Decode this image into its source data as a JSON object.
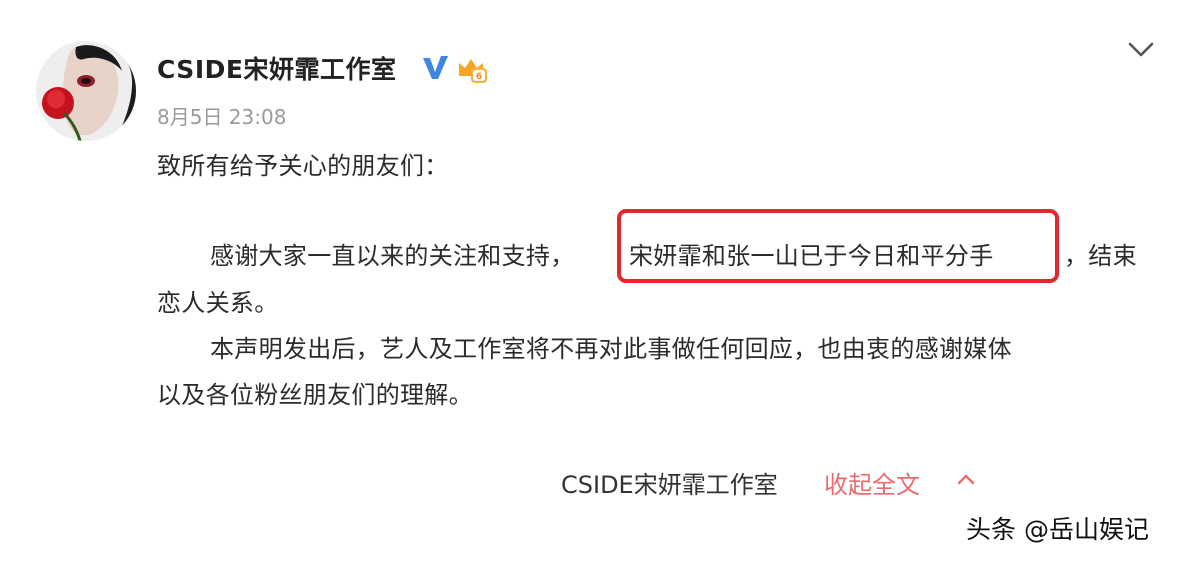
{
  "post": {
    "author": "CSIDE宋妍霏工作室",
    "timestamp": "8月5日 23:08",
    "greeting": "致所有给予关心的朋友们：",
    "paragraph1_start": "感谢大家一直以来的关注和支持，",
    "paragraph1_highlight": "宋妍霏和张一山已于今日和平分手",
    "paragraph1_tail": "，结束",
    "paragraph1_cont": "恋人关系。",
    "paragraph2_start": "本声明发出后，艺人及工作室将不再对此事做任何回应，也由衷的感谢媒体",
    "paragraph2_cont": "以及各位粉丝朋友们的理解。"
  },
  "footer": {
    "author": "CSIDE宋妍霏工作室",
    "collapse_label": "收起全文"
  },
  "watermark": "头条 @岳山娱记",
  "icons": {
    "avatar": "avatar",
    "verified": "verified-v-icon",
    "level": "vip-level-icon",
    "more": "chevron-down-icon",
    "collapse": "chevron-up-icon"
  },
  "colors": {
    "highlight_border": "#e6262e",
    "collapse_link": "#e86c6c",
    "verified": "#3f86e0",
    "level": "#f4a523"
  }
}
